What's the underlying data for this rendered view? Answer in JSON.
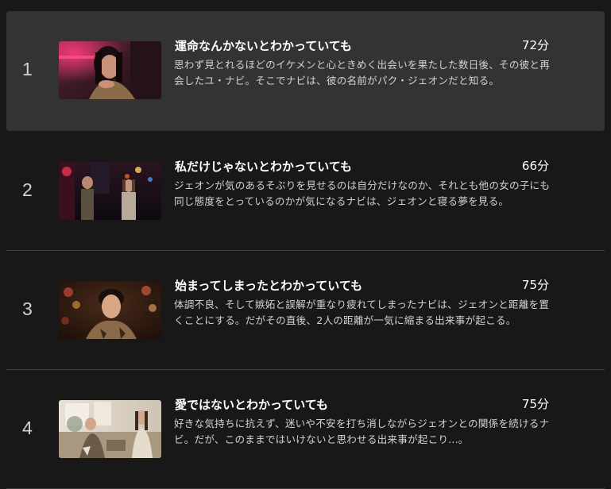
{
  "episodes": [
    {
      "index": "1",
      "title": "運命なんかないとわかっていても",
      "duration": "72分",
      "synopsis": "思わず見とれるほどのイケメンと心ときめく出会いを果たした数日後、その彼と再会したユ・ナビ。そこでナビは、彼の名前がパク・ジェオンだと知る。",
      "active": true
    },
    {
      "index": "2",
      "title": "私だけじゃないとわかっていても",
      "duration": "66分",
      "synopsis": "ジェオンが気のあるそぶりを見せるのは自分だけなのか、それとも他の女の子にも同じ態度をとっているのかが気になるナビは、ジェオンと寝る夢を見る。",
      "active": false
    },
    {
      "index": "3",
      "title": "始まってしまったとわかっていても",
      "duration": "75分",
      "synopsis": "体調不良、そして嫉妬と誤解が重なり疲れてしまったナビは、ジェオンと距離を置くことにする。だがその直後、2人の距離が一気に縮まる出来事が起こる。",
      "active": false
    },
    {
      "index": "4",
      "title": "愛ではないとわかっていても",
      "duration": "75分",
      "synopsis": "好きな気持ちに抗えず、迷いや不安を打ち消しながらジェオンとの関係を続けるナビ。だが、このままではいけないと思わせる出来事が起こり...。",
      "active": false
    }
  ],
  "colors": {
    "background": "#181818",
    "active_row": "#333333",
    "divider": "#404040",
    "title": "#ffffff",
    "secondary_text": "#d2d2d2"
  }
}
